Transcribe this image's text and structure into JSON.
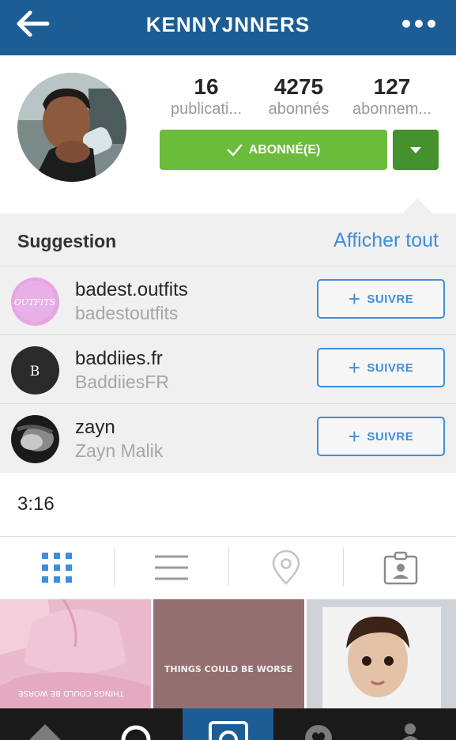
{
  "header": {
    "title": "KENNYJNNERS",
    "back_icon": "arrow-left-icon",
    "more_icon": "more-dots-icon",
    "bg_color": "#1d5d95"
  },
  "stats": [
    {
      "value": "16",
      "label": "publicati..."
    },
    {
      "value": "4275",
      "label": "abonnés"
    },
    {
      "value": "127",
      "label": "abonnem..."
    }
  ],
  "follow": {
    "label": "ABONNÉ(E)",
    "color": "#6cbc3c",
    "dropdown_color": "#45912c"
  },
  "suggestions": {
    "title": "Suggestion",
    "see_all": "Afficher tout",
    "items": [
      {
        "name": "badest.outfits",
        "handle": "badestoutfits",
        "button": "SUIVRE",
        "avatar_text": "OUTFITS"
      },
      {
        "name": "baddiies.fr",
        "handle": "BaddiiesFR",
        "button": "SUIVRE",
        "avatar_text": "B"
      },
      {
        "name": "zayn",
        "handle": "Zayn Malik",
        "button": "SUIVRE"
      }
    ]
  },
  "time": "3:16",
  "tabs": [
    "grid-view-icon",
    "list-view-icon",
    "location-pin-icon",
    "tagged-photos-icon"
  ],
  "grid": [
    {
      "caption": "THINGS COULD BE WORSE"
    },
    {
      "caption": "THINGS COULD BE WORSE"
    },
    {
      "caption": ""
    }
  ],
  "bottom_nav": [
    "home-icon",
    "search-icon",
    "camera-icon",
    "heart-icon",
    "profile-icon"
  ],
  "colors": {
    "accent": "#3f8edc"
  }
}
